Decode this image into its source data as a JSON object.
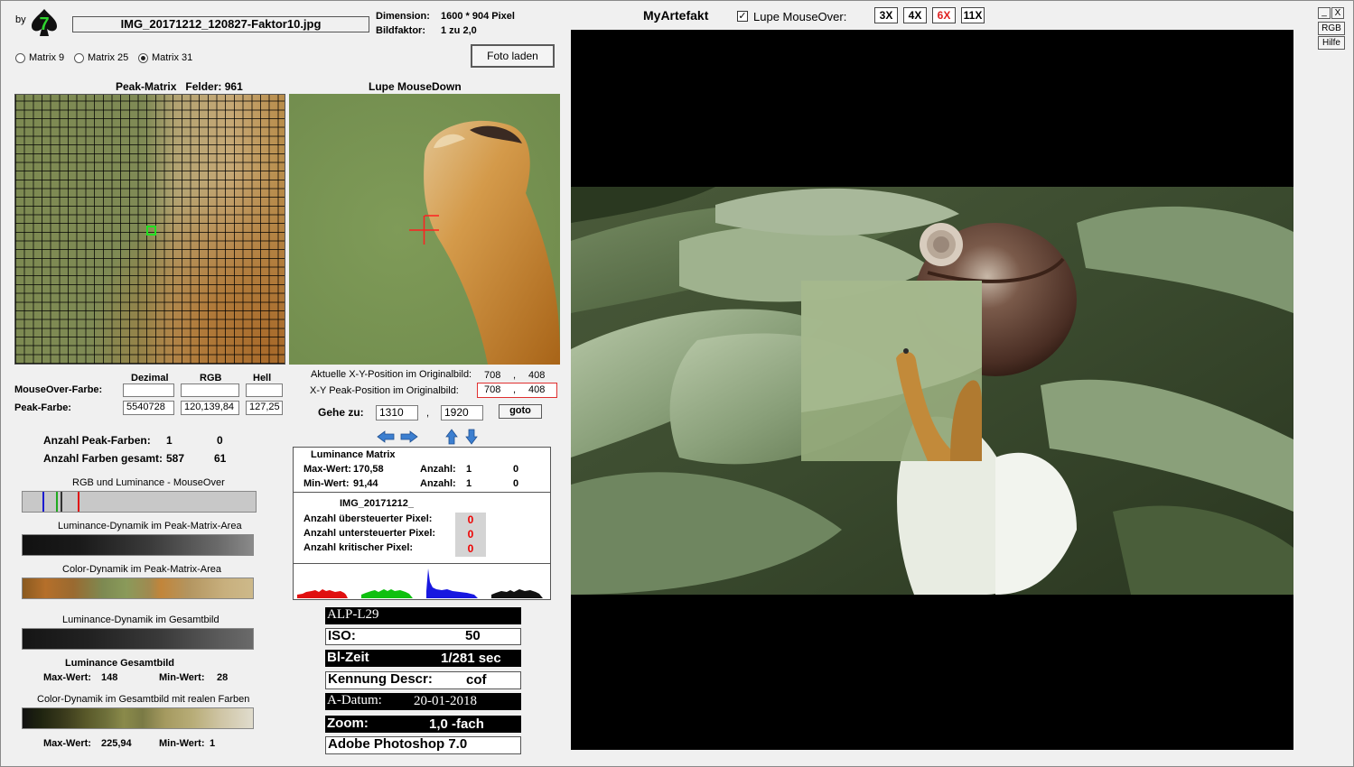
{
  "header": {
    "by_label": "by",
    "logo_digit": "7",
    "filename": "IMG_20171212_120827-Faktor10.jpg",
    "dimension_label": "Dimension:",
    "dimension_value": "1600 * 904 Pixel",
    "factor_label": "Bildfaktor:",
    "factor_value": "1 zu 2,0",
    "app_title": "MyArtefakt",
    "lupe_label": "Lupe MouseOver:",
    "lupe_checked": true,
    "zoom_buttons": [
      "3X",
      "4X",
      "6X",
      "11X"
    ],
    "active_zoom": "6X",
    "foto_button": "Foto laden"
  },
  "window_buttons": {
    "minimize": "_",
    "close": "X",
    "rgb": "RGB",
    "help": "Hilfe"
  },
  "matrix_options": [
    {
      "label": "Matrix 9",
      "selected": false
    },
    {
      "label": "Matrix 25",
      "selected": false
    },
    {
      "label": "Matrix 31",
      "selected": true
    }
  ],
  "peak_matrix": {
    "title": "Peak-Matrix",
    "felder_label": "Felder: 961"
  },
  "lupe_mousedown": {
    "title": "Lupe MouseDown"
  },
  "position": {
    "current_label": "Aktuelle X-Y-Position  im Originalbild:",
    "current_x": "708",
    "current_y": "408",
    "peak_label": "X-Y Peak-Position  im Originalbild:",
    "peak_x": "708",
    "peak_y": "408",
    "separator": ",",
    "goto_label": "Gehe zu:",
    "goto_x": "1310",
    "goto_y": "1920",
    "goto_button": "goto"
  },
  "colors": {
    "col_dezimal": "Dezimal",
    "col_rgb": "RGB",
    "col_hell": "Hell",
    "mouseover_label": "MouseOver-Farbe:",
    "peak_label": "Peak-Farbe:",
    "mouseover_dezimal": "",
    "mouseover_rgb": "",
    "mouseover_hell": "",
    "peak_dezimal": "5540728",
    "peak_rgb": "120,139,84",
    "peak_hell": "127,25"
  },
  "counts": {
    "peak_label": "Anzahl Peak-Farben:",
    "peak_a": "1",
    "peak_b": "0",
    "total_label": "Anzahl Farben gesamt:",
    "total_a": "587",
    "total_b": "61"
  },
  "bars": {
    "rgb_lum": "RGB und Luminance - MouseOver",
    "lum_peak": "Luminance-Dynamik im Peak-Matrix-Area",
    "color_peak": "Color-Dynamik im Peak-Matrix-Area",
    "lum_total": "Luminance-Dynamik im Gesamtbild",
    "lum_gesamt_title": "Luminance Gesamtbild",
    "lum_max_label": "Max-Wert:",
    "lum_max": "148",
    "lum_min_label": "Min-Wert:",
    "lum_min": "28",
    "color_total": "Color-Dynamik im Gesamtbild mit realen Farben",
    "color_max_label": "Max-Wert:",
    "color_max": "225,94",
    "color_min_label": "Min-Wert:",
    "color_min": "1"
  },
  "lum_matrix": {
    "title": "Luminance Matrix",
    "max_label": "Max-Wert:",
    "max_value": "170,58",
    "min_label": "Min-Wert:",
    "min_value": "91,44",
    "count_label": "Anzahl:",
    "max_count_a": "1",
    "max_count_b": "0",
    "min_count_a": "1",
    "min_count_b": "0"
  },
  "image_stats": {
    "name": "IMG_20171212_",
    "over_label": "Anzahl übersteuerter Pixel:",
    "over_value": "0",
    "under_label": "Anzahl untersteuerter Pixel:",
    "under_value": "0",
    "critical_label": "Anzahl kritischer Pixel:",
    "critical_value": "0"
  },
  "exif": {
    "model": "ALP-L29",
    "iso_label": "ISO:",
    "iso_value": "50",
    "exposure_label": "Bl-Zeit",
    "exposure_value": "1/281 sec",
    "descr_label": "Kennung Descr:",
    "descr_value": "cof",
    "date_label": "A-Datum:",
    "date_value": "20-01-2018",
    "zoom_label": "Zoom:",
    "zoom_value": "1,0 -fach",
    "software": "Adobe Photoshop 7.0"
  }
}
